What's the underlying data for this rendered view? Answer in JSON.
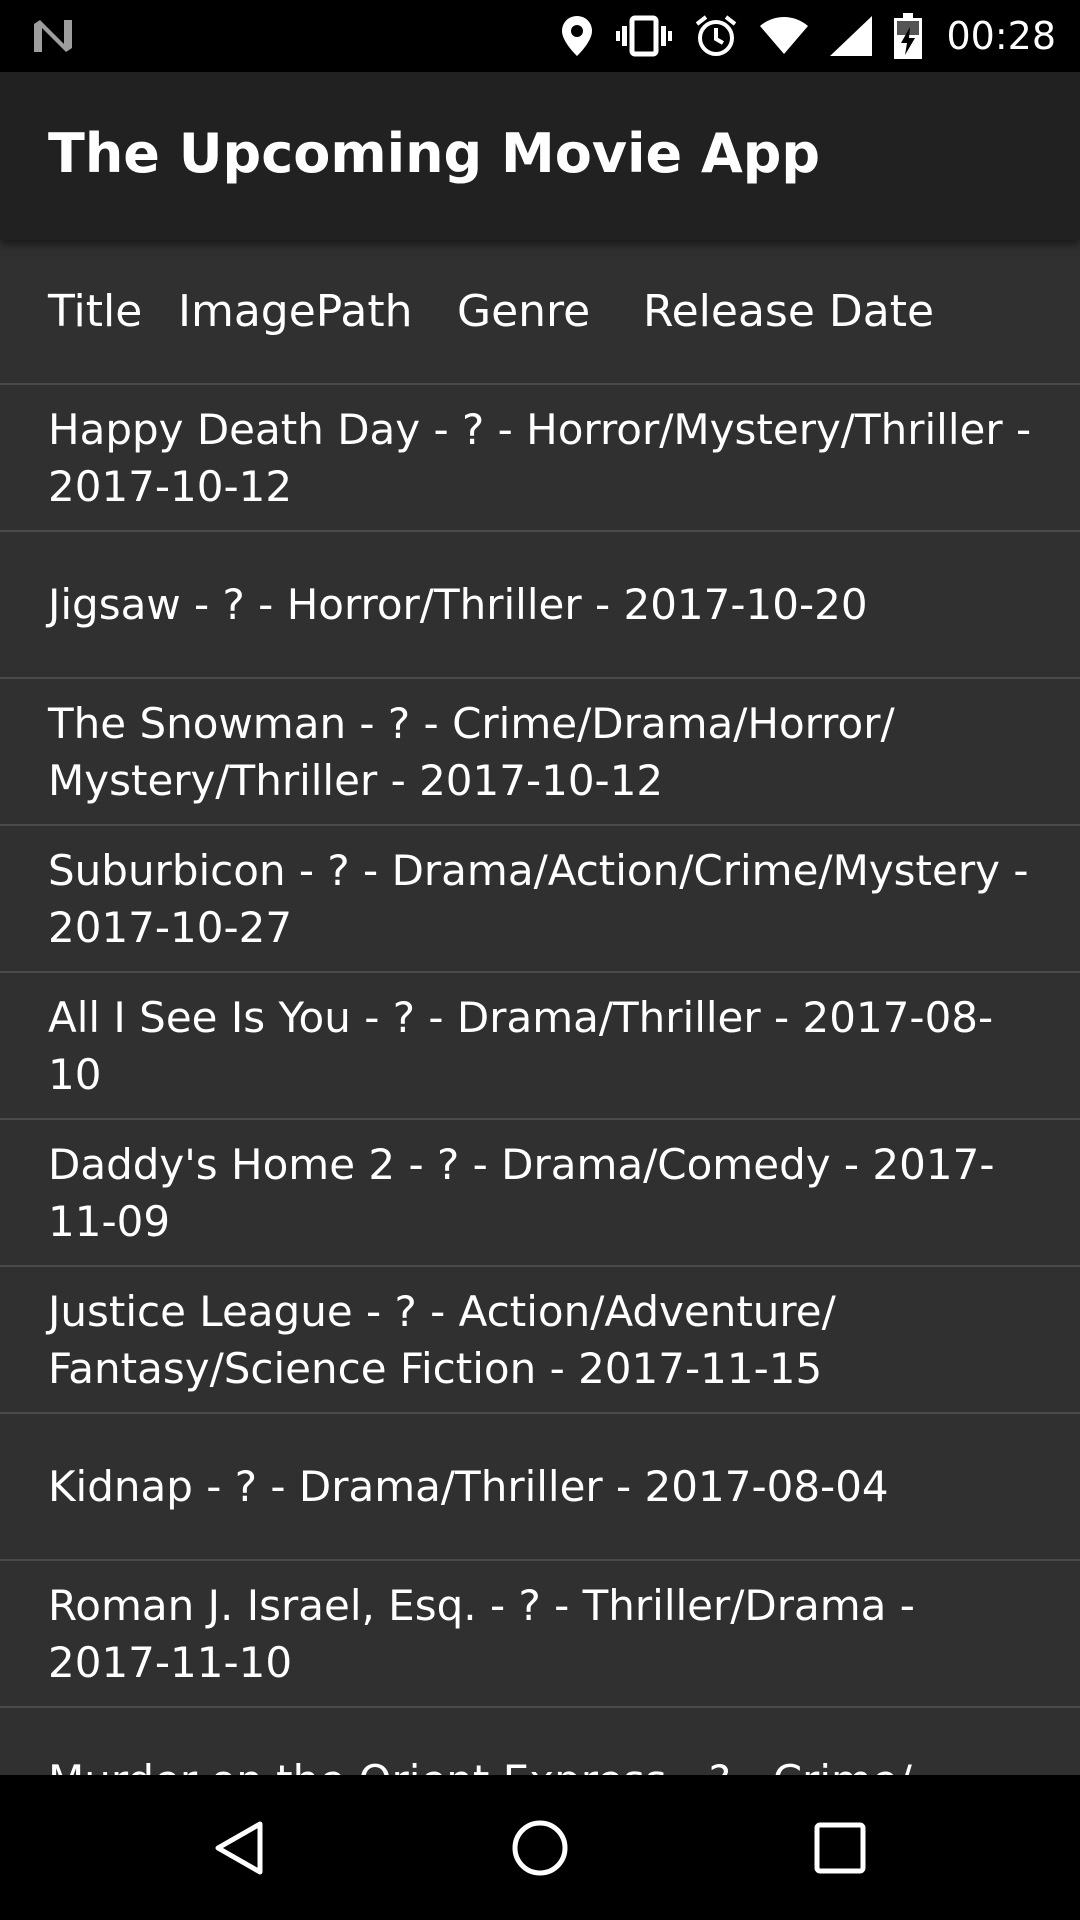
{
  "status_bar": {
    "time": "00:28",
    "icons": [
      "notification-n-icon",
      "location-icon",
      "vibrate-icon",
      "alarm-icon",
      "wifi-icon",
      "signal-icon",
      "battery-charging-icon"
    ]
  },
  "app_bar": {
    "title": "The Upcoming Movie App"
  },
  "header": {
    "columns": [
      "Title",
      "ImagePath",
      "Genre",
      "Release Date"
    ]
  },
  "movies": [
    "Happy Death Day - ? - Horror/Mystery/Thriller - 2017-10-12",
    "Jigsaw - ? - Horror/Thriller - 2017-10-20",
    "The Snowman - ? - Crime/Drama/Horror/ Mystery/Thriller - 2017-10-12",
    "Suburbicon - ? - Drama/Action/Crime/Mystery - 2017-10-27",
    "All I See Is You - ? - Drama/Thriller - 2017-08-10",
    "Daddy's Home 2 - ? - Drama/Comedy - 2017-11-09",
    "Justice League - ? - Action/Adventure/ Fantasy/Science Fiction - 2017-11-15",
    "Kidnap - ? - Drama/Thriller - 2017-08-04",
    "Roman J. Israel, Esq. - ? - Thriller/Drama - 2017-11-10",
    "Murder on the Orient Express - ? - Crime/"
  ],
  "nav_bar": {
    "buttons": [
      "back-icon",
      "home-icon",
      "recents-icon"
    ]
  }
}
